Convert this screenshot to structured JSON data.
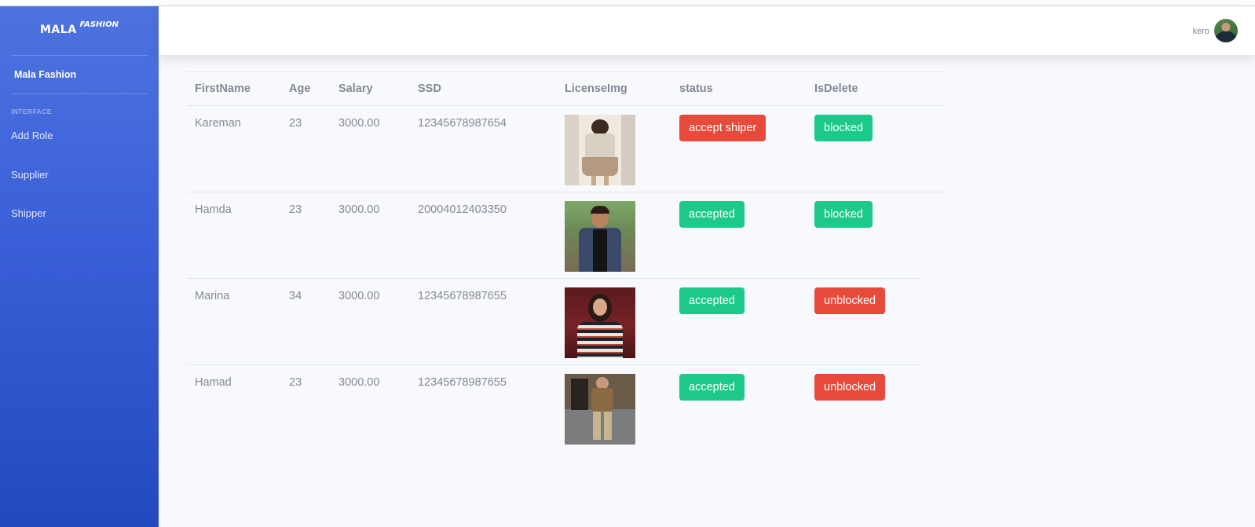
{
  "brand": {
    "main": "MALA",
    "sup": "FASHION"
  },
  "sidebar": {
    "active_item": "Mala Fashion",
    "heading": "INTERFACE",
    "items": [
      {
        "label": "Add Role"
      },
      {
        "label": "Supplier"
      },
      {
        "label": "Shipper"
      }
    ]
  },
  "topbar": {
    "user_name": "kero"
  },
  "table": {
    "headers": [
      "FirstName",
      "Age",
      "Salary",
      "SSD",
      "LicenseImg",
      "status",
      "IsDelete"
    ],
    "rows": [
      {
        "first_name": "Kareman",
        "age": "23",
        "salary": "3000.00",
        "ssd": "12345678987654",
        "status": "accept shiper",
        "status_color": "#e74a3b",
        "is_delete": "blocked",
        "is_delete_color": "#1cc88a"
      },
      {
        "first_name": "Hamda",
        "age": "23",
        "salary": "3000.00",
        "ssd": "20004012403350",
        "status": "accepted",
        "status_color": "#1cc88a",
        "is_delete": "blocked",
        "is_delete_color": "#1cc88a"
      },
      {
        "first_name": "Marina",
        "age": "34",
        "salary": "3000.00",
        "ssd": "12345678987655",
        "status": "accepted",
        "status_color": "#1cc88a",
        "is_delete": "unblocked",
        "is_delete_color": "#e74a3b"
      },
      {
        "first_name": "Hamad",
        "age": "23",
        "salary": "3000.00",
        "ssd": "12345678987655",
        "status": "accepted",
        "status_color": "#1cc88a",
        "is_delete": "unblocked",
        "is_delete_color": "#e74a3b"
      }
    ]
  },
  "colors": {
    "sidebar_top": "#4e73df",
    "sidebar_bottom": "#224abe",
    "danger": "#e74a3b",
    "success": "#1cc88a",
    "text_muted": "#858796"
  }
}
